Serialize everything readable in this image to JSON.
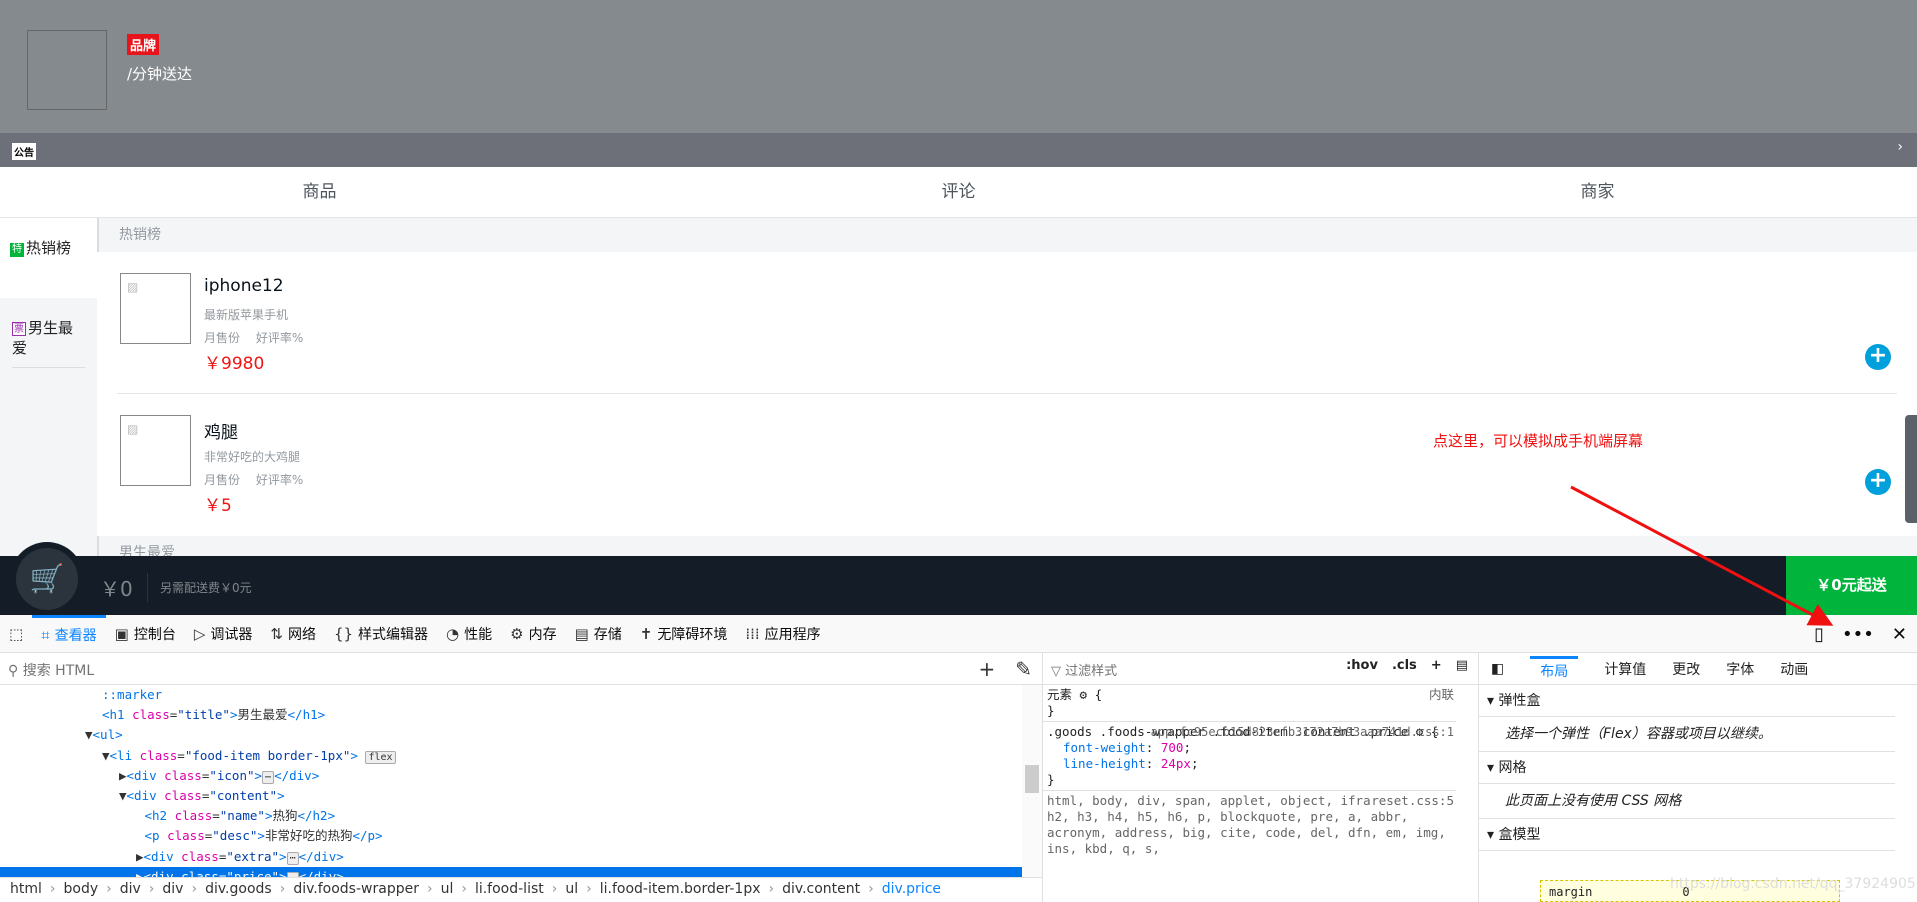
{
  "header": {
    "brand": "品牌",
    "delivery": "/分钟送达",
    "notice_badge": "公告",
    "notice_arrow": "›"
  },
  "tabs": [
    "商品",
    "评论",
    "商家"
  ],
  "menu": [
    {
      "badge": "特",
      "label": "热销榜",
      "color": "#00b43c"
    },
    {
      "badge": "票",
      "label": "男生最爱",
      "color": "#9b2fae"
    }
  ],
  "sections": [
    {
      "title": "热销榜",
      "items": [
        {
          "name": "iphone12",
          "desc": "最新版苹果手机",
          "extra": "月售份 好评率%",
          "price": "￥9980"
        },
        {
          "name": "鸡腿",
          "desc": "非常好吃的大鸡腿",
          "extra": "月售份 好评率%",
          "price": "￥5"
        }
      ]
    },
    {
      "title": "男生最爱"
    }
  ],
  "cart": {
    "total": "￥0",
    "fee": "另需配送费￥0元",
    "pay": "￥0元起送"
  },
  "annotation": "点这里，可以模拟成手机端屏幕",
  "devtools": {
    "tabs": [
      {
        "icon": "⌗",
        "label": "查看器",
        "active": true
      },
      {
        "icon": "▣",
        "label": "控制台"
      },
      {
        "icon": "▷",
        "label": "调试器"
      },
      {
        "icon": "⇅",
        "label": "网络"
      },
      {
        "icon": "{}",
        "label": "样式编辑器"
      },
      {
        "icon": "◔",
        "label": "性能"
      },
      {
        "icon": "⚙",
        "label": "内存"
      },
      {
        "icon": "▤",
        "label": "存储"
      },
      {
        "icon": "✝",
        "label": "无障碍环境"
      },
      {
        "icon": "⁞⁞⁞",
        "label": "应用程序"
      }
    ],
    "search_placeholder": "搜索 HTML",
    "tree": [
      {
        "indent": 12,
        "html": "<span class='tg'>::marker</span>"
      },
      {
        "indent": 12,
        "html": "<span class='tg'>&lt;h1</span> <span class='at'>class</span>=<span class='av'>\"title\"</span><span class='tg'>&gt;</span>男生最爱<span class='tg'>&lt;/h1&gt;</span>"
      },
      {
        "indent": 10,
        "html": "▼<span class='tg'>&lt;ul&gt;</span>"
      },
      {
        "indent": 12,
        "html": "▼<span class='tg'>&lt;li</span> <span class='at'>class</span>=<span class='av'>\"food-item border-1px\"</span><span class='tg'>&gt;</span> <span class='badge'>flex</span>"
      },
      {
        "indent": 14,
        "html": "▶<span class='tg'>&lt;div</span> <span class='at'>class</span>=<span class='av'>\"icon\"</span><span class='tg'>&gt;</span><span class='badge'>⋯</span><span class='tg'>&lt;/div&gt;</span>"
      },
      {
        "indent": 14,
        "html": "▼<span class='tg'>&lt;div</span> <span class='at'>class</span>=<span class='av'>\"content\"</span><span class='tg'>&gt;</span>"
      },
      {
        "indent": 17,
        "html": "<span class='tg'>&lt;h2</span> <span class='at'>class</span>=<span class='av'>\"name\"</span><span class='tg'>&gt;</span>热狗<span class='tg'>&lt;/h2&gt;</span>"
      },
      {
        "indent": 17,
        "html": "<span class='tg'>&lt;p</span> <span class='at'>class</span>=<span class='av'>\"desc\"</span><span class='tg'>&gt;</span>非常好吃的热狗<span class='tg'>&lt;/p&gt;</span>"
      },
      {
        "indent": 16,
        "html": "▶<span class='tg'>&lt;div</span> <span class='at'>class</span>=<span class='av'>\"extra\"</span><span class='tg'>&gt;</span><span class='badge'>⋯</span><span class='tg'>&lt;/div&gt;</span>"
      },
      {
        "indent": 16,
        "sel": true,
        "html": "▶<span class='tg'>&lt;div</span> <span class='at'>class</span>=<span class='av'>\"price\"</span><span class='tg'>&gt;</span><span class='badge'>⋯</span><span class='tg'>&lt;/div&gt;</span>"
      }
    ],
    "breadcrumbs": [
      "html",
      "body",
      "div",
      "div",
      "div.goods",
      "div.foods-wrapper",
      "ul",
      "li.food-list",
      "ul",
      "li.food-item.border-1px",
      "div.content",
      "div.price"
    ],
    "rules": {
      "filter_placeholder": "过滤样式",
      "hov": ":hov",
      "cls": ".cls",
      "element": "元素 ⚙ {",
      "element_close": "}",
      "inline": "内联",
      "r1_selector": ".goods .foods-wrapper .food-item .content .price ⚙ {",
      "r1_source": "app.fc95ecb15d823cfb3172a7b93aaa741d.css:1",
      "r1_props": [
        [
          "font-weight",
          "700"
        ],
        [
          "line-height",
          "24px"
        ]
      ],
      "r2_selector": "html, body, div, span, applet, object, iframe, h1, h2, h3, h4, h5, h6, p, blockquote, pre, a, abbr, acronym, address, big, cite, code, del, dfn, em, img, ins, kbd, q, s,",
      "r2_source": "reset.css:5"
    },
    "layout": {
      "tabs": [
        "布局",
        "计算值",
        "更改",
        "字体",
        "动画"
      ],
      "flex_title": "弹性盒",
      "flex_msg": "选择一个弹性（Flex）容器或项目以继续。",
      "grid_title": "网格",
      "grid_msg": "此页面上没有使用 CSS 网格",
      "box_title": "盒模型",
      "margin_label": "margin",
      "margin_value": "0"
    },
    "watermark": "https://blog.csdn.net/qq_37924905"
  },
  "colors": {
    "accent": "#0a84ff",
    "pay": "#00b43c",
    "price": "#f01414",
    "add": "#00a0dc",
    "annotation": "#f01010"
  }
}
